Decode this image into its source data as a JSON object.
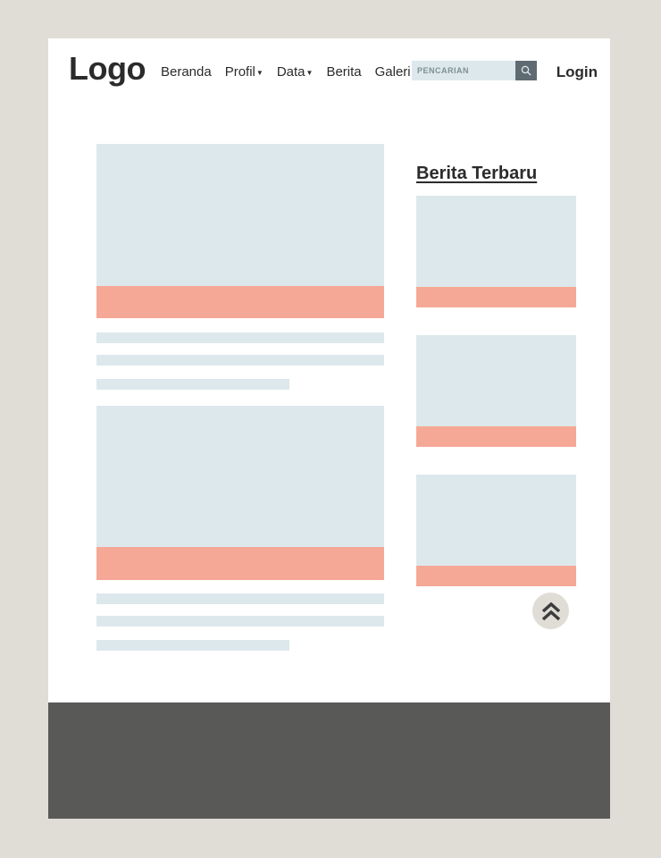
{
  "header": {
    "logo": "Logo",
    "nav": [
      {
        "label": "Beranda",
        "dropdown": false
      },
      {
        "label": "Profil",
        "dropdown": true
      },
      {
        "label": "Data",
        "dropdown": true
      },
      {
        "label": "Berita",
        "dropdown": false
      },
      {
        "label": "Galeri",
        "dropdown": false
      }
    ],
    "search": {
      "placeholder": "PENCARIAN",
      "icon": "search-icon"
    },
    "login_label": "Login"
  },
  "sidebar": {
    "title": "Berita Terbaru",
    "news_count": 3
  },
  "main": {
    "article_count": 2
  },
  "controls": {
    "scroll_top_icon": "double-chevron-up-icon"
  },
  "colors": {
    "page_background": "#e0ddd6",
    "content_background": "#ffffff",
    "placeholder_image": "#dde8ec",
    "caption_bar": "#f6a896",
    "footer": "#595958",
    "search_button": "#5f6b73",
    "text": "#2b2b2b"
  }
}
